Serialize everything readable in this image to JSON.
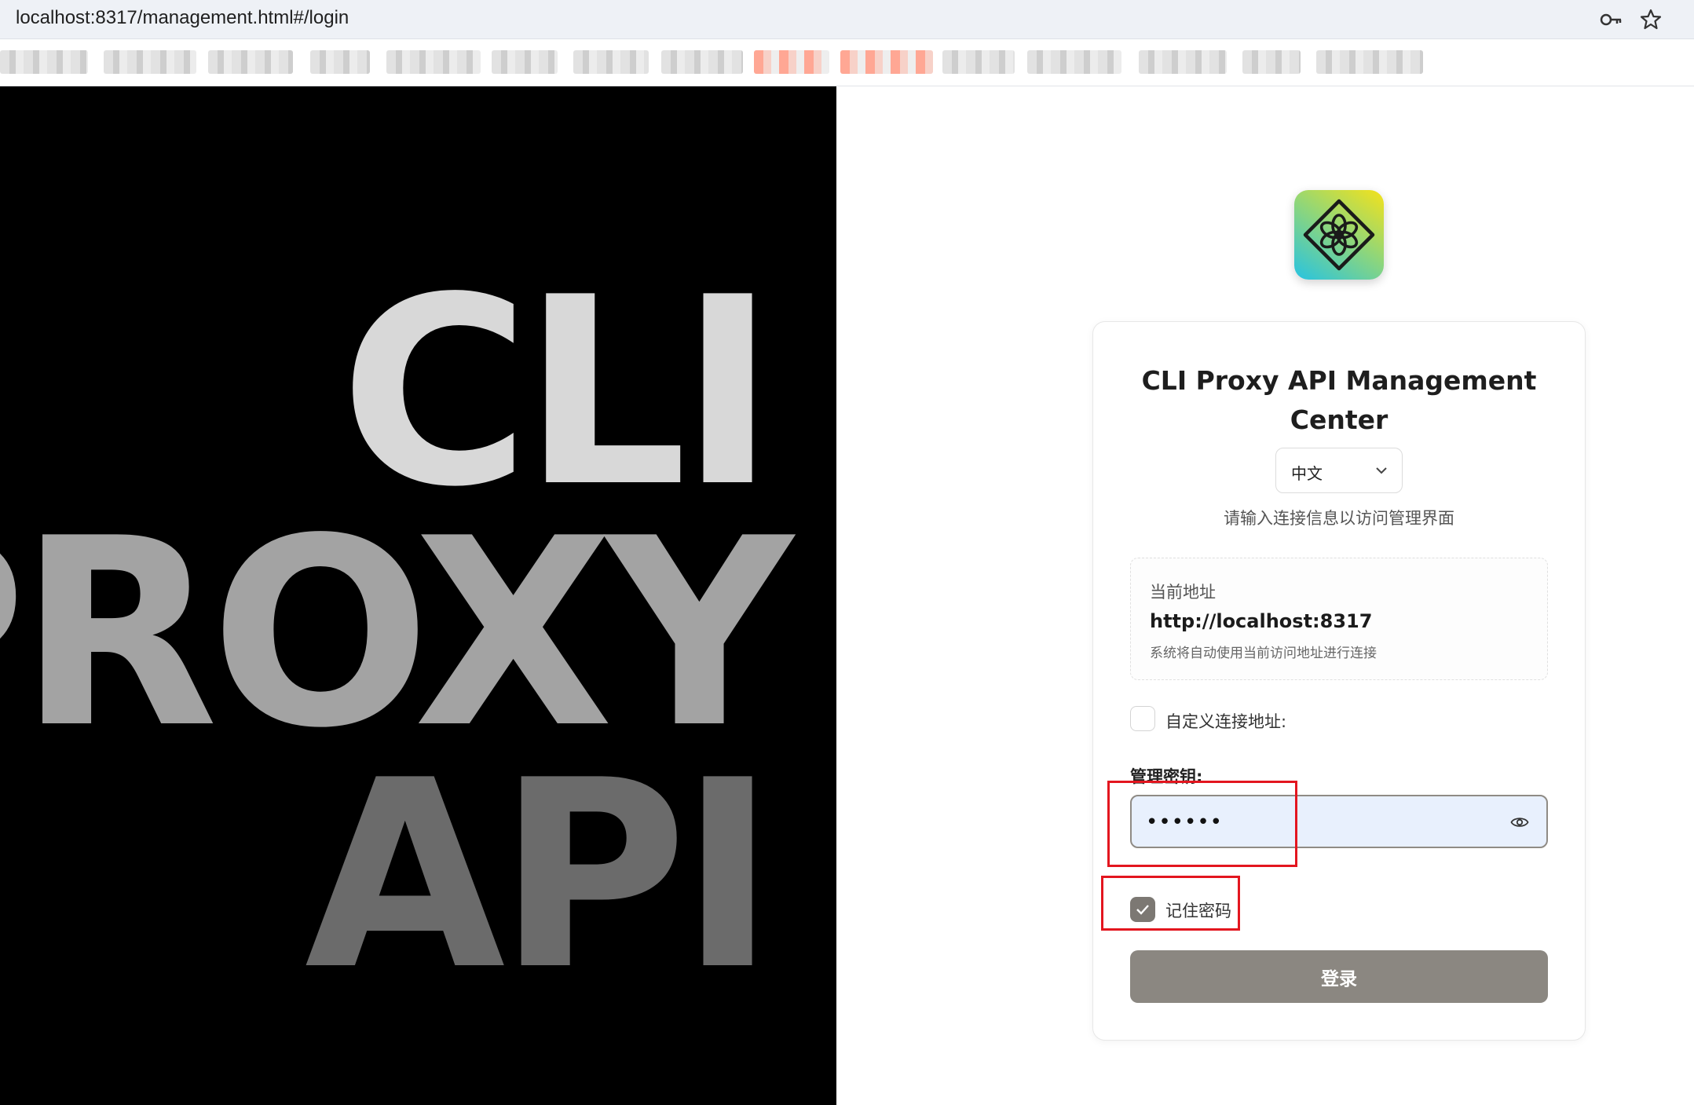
{
  "browser": {
    "url": "localhost:8317/management.html#/login",
    "icons": [
      "key-icon",
      "star-icon"
    ]
  },
  "hero": {
    "words": [
      "CLI",
      "PROXY",
      "API"
    ]
  },
  "card": {
    "title": "CLI Proxy API Management Center",
    "language": {
      "selected": "中文"
    },
    "subtitle": "请输入连接信息以访问管理界面",
    "address": {
      "label": "当前地址",
      "value": "http://localhost:8317",
      "hint": "系统将自动使用当前访问地址进行连接"
    },
    "custom_address": {
      "label": "自定义连接地址:",
      "checked": false
    },
    "management_key": {
      "label": "管理密钥:",
      "value": "••••••",
      "icon": "eye-icon"
    },
    "remember": {
      "label": "记住密码",
      "checked": true
    },
    "login_button": "登录"
  },
  "colors": {
    "hero_bg": "#000000",
    "button": "#8b8781",
    "input_bg": "#e8f0fd",
    "annotation": "#e3161f"
  }
}
